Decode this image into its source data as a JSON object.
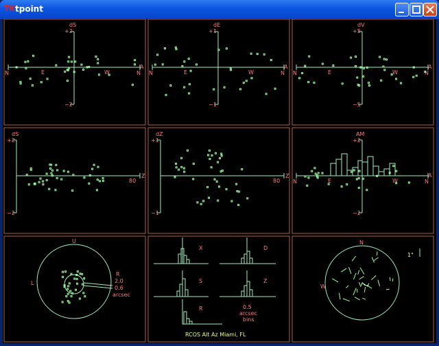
{
  "window": {
    "title": "tpoint",
    "app_icon_label": "TK",
    "buttons": {
      "minimize": "minimize",
      "maximize": "maximize",
      "close": "close"
    }
  },
  "colors": {
    "frame": "#b0623a",
    "axis": "#9ef0c0",
    "text": "#ff7a7a",
    "points": "#9cff9c",
    "footer": "#e8ff80"
  },
  "panels": {
    "dS_az": {
      "title": "dS",
      "ytop": "+2",
      "ybot": "−2",
      "xlabels": [
        "N",
        "E",
        "W",
        "N",
        "A"
      ]
    },
    "dE_az": {
      "title": "dE",
      "ytop": "+1",
      "ybot": "−1",
      "xlabels": [
        "N",
        "E",
        "W",
        "N",
        "A"
      ]
    },
    "dV_az": {
      "title": "dV",
      "ytop": "+5",
      "ybot": "−5",
      "xlabels": [
        "N",
        "E",
        "W",
        "N",
        "A"
      ]
    },
    "dS_zd": {
      "title": "dS",
      "ytop": "+2",
      "ybot": "−2",
      "xlabels": [
        "80",
        "Z"
      ]
    },
    "dZ_zd": {
      "title": "dZ",
      "ytop": "+1",
      "ybot": "−1",
      "xlabels": [
        "80",
        "Z"
      ]
    },
    "AM": {
      "title": "AM",
      "ytop": "+2",
      "ybot": "−2",
      "xlabels": [
        "N",
        "E",
        "W",
        "N",
        "A"
      ]
    },
    "scatter": {
      "top": "U",
      "left": "L",
      "r_label": "R",
      "r1": "2.0",
      "r2": "0.6",
      "unit": "arcsec"
    },
    "histograms": {
      "labels": [
        "X",
        "D",
        "S",
        "Z",
        "R"
      ],
      "bin": "0.5",
      "bin_unit": "arcsec",
      "bin_word": "bins",
      "footer": "RCOS Alt Az Miami, FL"
    },
    "sky": {
      "north": "N",
      "west": "W",
      "scale": "1\""
    }
  }
}
